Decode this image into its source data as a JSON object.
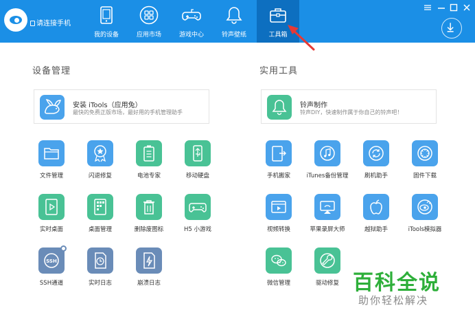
{
  "header": {
    "connect_text": "请连接手机",
    "tabs": [
      {
        "label": "我的设备",
        "icon": "device-icon"
      },
      {
        "label": "应用市场",
        "icon": "app-market-icon"
      },
      {
        "label": "游戏中心",
        "icon": "gamepad-icon"
      },
      {
        "label": "铃声壁纸",
        "icon": "bell-icon"
      },
      {
        "label": "工具箱",
        "icon": "toolbox-icon",
        "active": true
      }
    ],
    "window_controls": [
      "menu-icon",
      "minimize-icon",
      "maximize-icon",
      "close-icon"
    ],
    "download_icon": "download-icon"
  },
  "device_section": {
    "title": "设备管理",
    "promo": {
      "title": "安装 iTools（应用兔）",
      "subtitle": "最快的免费正版市场，最好用的手机管理助手",
      "icon": "rabbit-icon"
    },
    "tools": [
      {
        "label": "文件管理",
        "icon": "folder-icon",
        "color": "blue"
      },
      {
        "label": "闪退修复",
        "icon": "star-badge-icon",
        "color": "blue"
      },
      {
        "label": "电池专家",
        "icon": "battery-icon",
        "color": "green"
      },
      {
        "label": "移动硬盘",
        "icon": "usb-icon",
        "color": "green"
      },
      {
        "label": "实时桌面",
        "icon": "play-icon",
        "color": "green"
      },
      {
        "label": "桌面管理",
        "icon": "grid-icon",
        "color": "green"
      },
      {
        "label": "删除废图标",
        "icon": "trash-icon",
        "color": "green"
      },
      {
        "label": "H5 小游戏",
        "icon": "gamepad-icon",
        "color": "green"
      },
      {
        "label": "SSH通道",
        "icon": "ssh-icon",
        "color": "slate"
      },
      {
        "label": "实时日志",
        "icon": "clock-doc-icon",
        "color": "slate"
      },
      {
        "label": "崩溃日志",
        "icon": "flash-doc-icon",
        "color": "slate"
      }
    ]
  },
  "utility_section": {
    "title": "实用工具",
    "promo": {
      "title": "铃声制作",
      "subtitle": "铃声DIY，快速制作属于你自己的铃声吧！",
      "icon": "bell-icon"
    },
    "tools": [
      {
        "label": "手机搬家",
        "icon": "phone-move-icon",
        "color": "blue"
      },
      {
        "label": "iTunes备份管理",
        "icon": "music-icon",
        "color": "blue"
      },
      {
        "label": "刷机助手",
        "icon": "refresh-icon",
        "color": "blue"
      },
      {
        "label": "固件下载",
        "icon": "gear-icon",
        "color": "blue"
      },
      {
        "label": "视频转换",
        "icon": "video-icon",
        "color": "blue"
      },
      {
        "label": "苹果录屏大师",
        "icon": "airplay-icon",
        "color": "blue"
      },
      {
        "label": "越狱助手",
        "icon": "apple-icon",
        "color": "blue"
      },
      {
        "label": "iTools模拟器",
        "icon": "eye-logo-icon",
        "color": "blue"
      },
      {
        "label": "微信管理",
        "icon": "wechat-icon",
        "color": "green"
      },
      {
        "label": "驱动修复",
        "icon": "wrench-icon",
        "color": "green"
      }
    ]
  },
  "watermark": {
    "big": "百科全说",
    "small": "助你轻松解决"
  },
  "colors": {
    "header": "#1b8fe6",
    "active_tab": "#0d6fc0",
    "blue_tile": "#4aa3ec",
    "green_tile": "#49c295",
    "slate_tile": "#6a8cb8",
    "arrow": "#e53935",
    "watermark": "#2eaf3a"
  }
}
